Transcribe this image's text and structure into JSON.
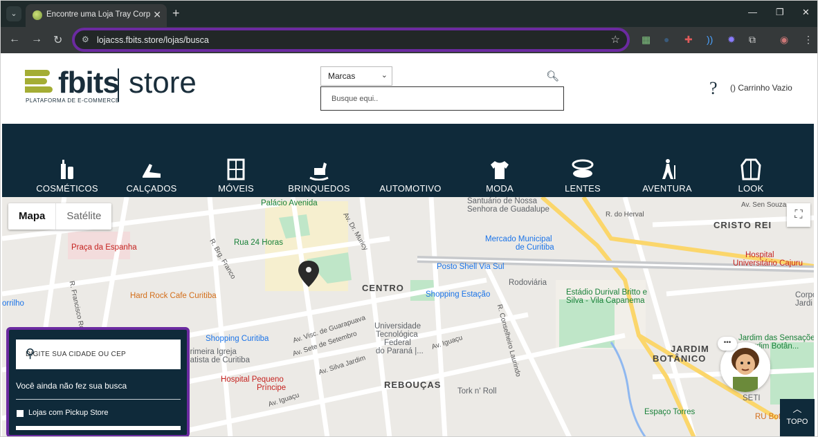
{
  "browser": {
    "tab_title": "Encontre uma Loja Tray Corp p",
    "url": "lojacss.fbits.store/lojas/busca"
  },
  "header": {
    "logo_word": "fbits",
    "logo_store": "store",
    "logo_tagline": "PLATAFORMA DE E-COMMERCE",
    "brand_select_value": "Marcas",
    "search_placeholder": "Busque equi..",
    "help_label": "?",
    "cart_label": "() Carrinho Vazio"
  },
  "categories": [
    {
      "label": "COSMÉTICOS",
      "icon": "cosmetics-icon"
    },
    {
      "label": "CALÇADOS",
      "icon": "shoes-icon"
    },
    {
      "label": "MÓVEIS",
      "icon": "furniture-icon"
    },
    {
      "label": "BRINQUEDOS",
      "icon": "rocking-horse-icon"
    },
    {
      "label": "AUTOMOTIVO",
      "icon": "car-icon"
    },
    {
      "label": "MODA",
      "icon": "tshirt-icon"
    },
    {
      "label": "LENTES",
      "icon": "lenses-icon"
    },
    {
      "label": "AVENTURA",
      "icon": "hiker-icon"
    },
    {
      "label": "LOOK",
      "icon": "jacket-icon"
    }
  ],
  "map": {
    "type_buttons": {
      "map": "Mapa",
      "satellite": "Satélite"
    },
    "labels": {
      "palacio": "Palácio Avenida",
      "santuario1": "Santuário de Nossa",
      "santuario2": "Senhora de Guadalupe",
      "dr_muricy": "Av. Dr. Muricy",
      "sete": "Av. Sete de Setembro",
      "visc": "Av. Visc. de Guarapuava",
      "praca": "Praça da Espanha",
      "rua24": "Rua 24 Horas",
      "mercado1": "Mercado Municipal",
      "mercado2": "de Curitiba",
      "posto": "Posto Shell Via Sul",
      "centro": "CENTRO",
      "rodoviaria": "Rodoviária",
      "estadio1": "Estádio Durival Britto e",
      "estadio2": "Silva - Vila Capanema",
      "shopping_estacao": "Shopping Estação",
      "hardrock": "Hard Rock Cafe Curitiba",
      "crisrorei": "CRISTO REI",
      "hospital_caj1": "Hospital",
      "hospital_caj2": "Universitário Cajuru",
      "univ1": "Universidade",
      "univ2": "Tecnológica",
      "univ3": "Federal",
      "univ4": "do Paraná |...",
      "shopping_curitiba": "Shopping Curitiba",
      "igreja1": "Primeira Igreja",
      "igreja2": "Batista de Curitiba",
      "hospital_peq1": "Hospital Pequeno",
      "hospital_peq2": "Príncipe",
      "reboucas": "REBOUÇAS",
      "torknroll": "Tork n' Roll",
      "jardim_botanico1": "JARDIM",
      "jardim_botanico2": "BOTÂNICO",
      "jardim_sensacoes1": "Jardim das Sensações",
      "jardim_sensacoes2": "Jardim Botân...",
      "espaco_torres": "Espaço Torres",
      "ru": "RU Bot",
      "seti": "SETI",
      "iguacu": "Av. Iguaçu",
      "iguacu2": "Av. Iguaçu",
      "silva_jardim": "Av. Silva Jardim",
      "conselheiro": "R. Conselheiro Laurindo",
      "francisco": "R. Francisco Rocha",
      "brig_franco": "R. Brg. Franco",
      "ahu": "Av. Sen Souza",
      "herval": "R. do Herval",
      "corpo1": "Corpo",
      "corpo2": "Jardi",
      "orillo": "orrilho"
    }
  },
  "store_panel": {
    "search_placeholder": "DIGITE SUA CIDADE OU CEP",
    "message": "Você ainda não fez sua busca",
    "pickup_label": "Lojas com Pickup Store"
  },
  "topo_label": "TOPO",
  "colors": {
    "navy": "#0f2a3a",
    "accent_purple": "#6b2aa0",
    "logo_green": "#a4ad34"
  }
}
